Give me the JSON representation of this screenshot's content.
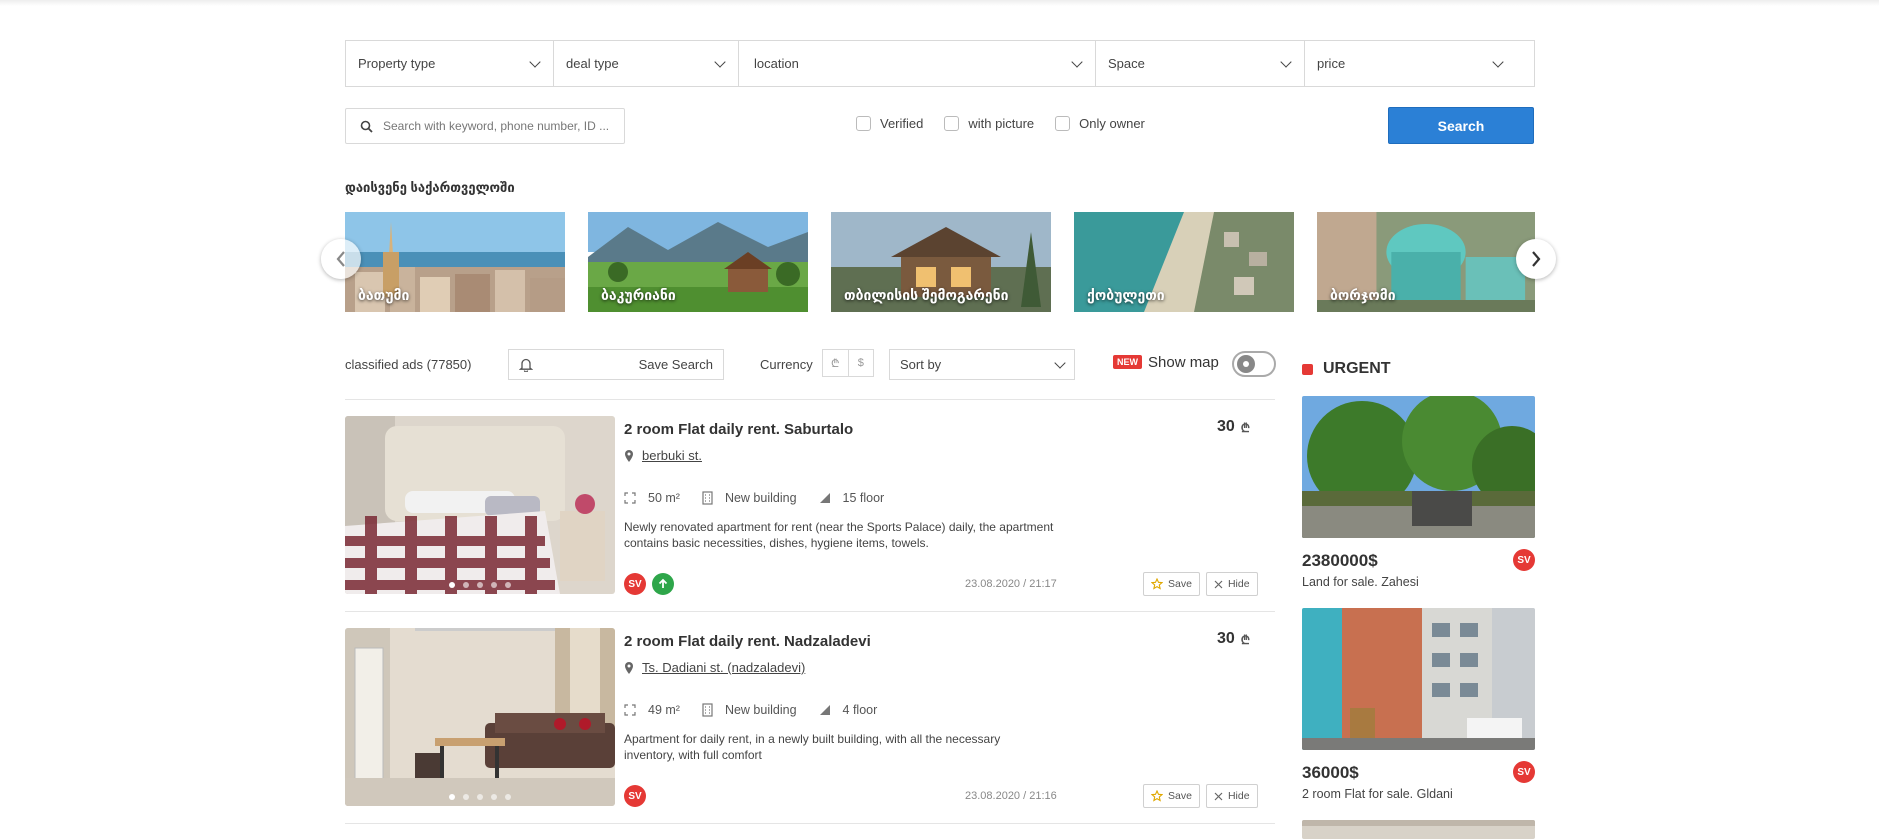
{
  "filters": {
    "property_type": "Property type",
    "deal_type": "deal type",
    "location": "location",
    "space": "Space",
    "price": "price"
  },
  "search": {
    "placeholder": "Search with keyword, phone number, ID ...",
    "button": "Search"
  },
  "checkboxes": {
    "verified": "Verified",
    "with_picture": "with picture",
    "only_owner": "Only owner"
  },
  "section_title": "დაისვენე საქართველოში",
  "destinations": [
    "ბათუმი",
    "ბაკურიანი",
    "თბილისის შემოგარენი",
    "ქობულეთი",
    "ბორჯომი"
  ],
  "toolbar": {
    "count": "classified ads (77850)",
    "save_search": "Save Search",
    "currency_label": "Currency",
    "currency_options": [
      "₾",
      "$"
    ],
    "sort_by": "Sort by",
    "new_badge": "NEW",
    "show_map": "Show map"
  },
  "listings": [
    {
      "title": "2 room Flat daily rent. Saburtalo",
      "address": "berbuki st.",
      "area": "50 m²",
      "building": "New building",
      "floor": "15 floor",
      "description": "Newly renovated apartment for rent (near the Sports Palace) daily, the apartment contains basic necessities, dishes, hygiene items, towels.",
      "date": "23.08.2020 / 21:17",
      "price": "30",
      "price_currency": "₾",
      "sv_badge": "SV",
      "save": "Save",
      "hide": "Hide"
    },
    {
      "title": "2 room Flat daily rent. Nadzaladevi",
      "address": "Ts. Dadiani st. (nadzaladevi)",
      "area": "49 m²",
      "building": "New building",
      "floor": "4 floor",
      "description": "Apartment for daily rent, in a newly built building, with all the necessary inventory, with full comfort",
      "date": "23.08.2020 / 21:16",
      "price": "30",
      "price_currency": "₾",
      "sv_badge": "SV",
      "save": "Save",
      "hide": "Hide"
    }
  ],
  "urgent": {
    "title": "URGENT",
    "items": [
      {
        "price": "2380000",
        "currency": "$",
        "description": "Land for sale. Zahesi",
        "badge": "SV"
      },
      {
        "price": "36000",
        "currency": "$",
        "description": "2 room Flat for sale. Gldani",
        "badge": "SV"
      }
    ]
  },
  "colors": {
    "accent": "#2b80d6",
    "urgent": "#e53935",
    "boost": "#2ea64a"
  }
}
